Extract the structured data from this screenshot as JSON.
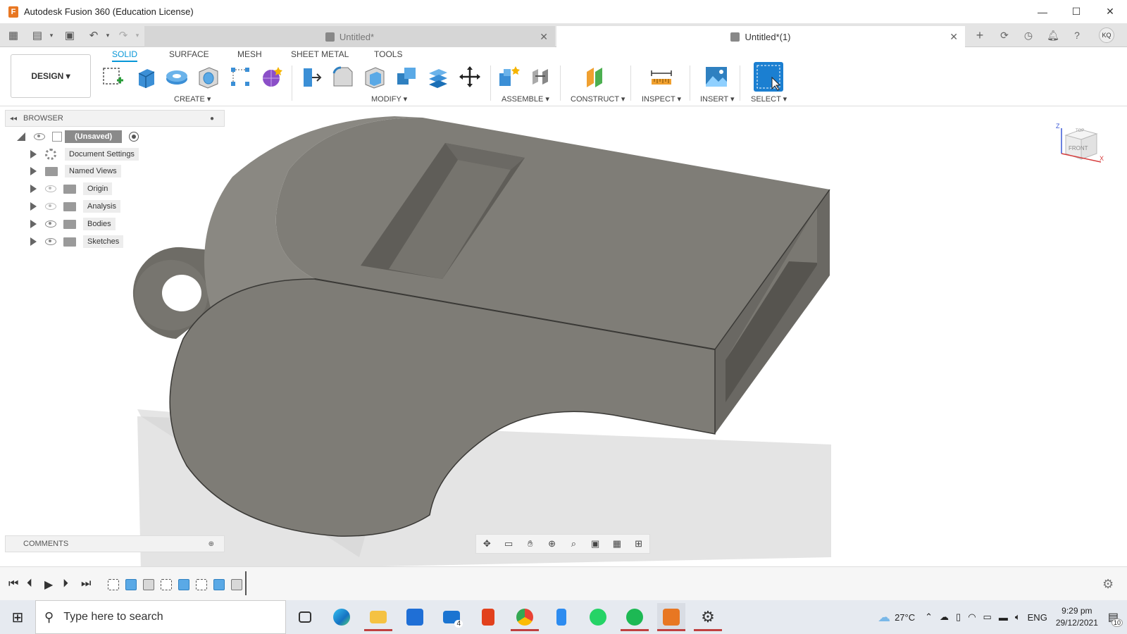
{
  "window": {
    "app_icon_letter": "F",
    "title": "Autodesk Fusion 360 (Education License)",
    "minimize": "—",
    "maximize": "☐",
    "close": "✕"
  },
  "tabs": [
    {
      "label": "Untitled*",
      "active": false
    },
    {
      "label": "Untitled*(1)",
      "active": true
    }
  ],
  "user_initials": "KQ",
  "workspace": {
    "label": "DESIGN ▾"
  },
  "ribbon_tabs": [
    "SOLID",
    "SURFACE",
    "MESH",
    "SHEET METAL",
    "TOOLS"
  ],
  "groups": {
    "create": "CREATE ▾",
    "modify": "MODIFY ▾",
    "assemble": "ASSEMBLE ▾",
    "construct": "CONSTRUCT ▾",
    "inspect": "INSPECT ▾",
    "insert": "INSERT ▾",
    "select": "SELECT ▾"
  },
  "browser": {
    "title": "BROWSER",
    "root": "(Unsaved)",
    "items": [
      {
        "label": "Document Settings",
        "icon": "gear-icon"
      },
      {
        "label": "Named Views",
        "icon": "folder-icon"
      },
      {
        "label": "Origin",
        "icon": "folder-icon",
        "visible": false
      },
      {
        "label": "Analysis",
        "icon": "folder-icon",
        "visible": false
      },
      {
        "label": "Bodies",
        "icon": "folder-icon",
        "visible": true
      },
      {
        "label": "Sketches",
        "icon": "folder-icon",
        "visible": true
      }
    ]
  },
  "comments": {
    "title": "COMMENTS"
  },
  "viewcube": {
    "face": "FRONT",
    "top": "TOP",
    "axis_z": "Z",
    "axis_x": "X"
  },
  "taskbar": {
    "search_placeholder": "Type here to search",
    "weather": "27°C",
    "language": "ENG",
    "time": "9:29 pm",
    "date": "29/12/2021",
    "notification_count": "10",
    "mail_badge": "4"
  },
  "colors": {
    "accent": "#0696d7",
    "model": "#7d7b75",
    "fusion_orange": "#e87722"
  }
}
